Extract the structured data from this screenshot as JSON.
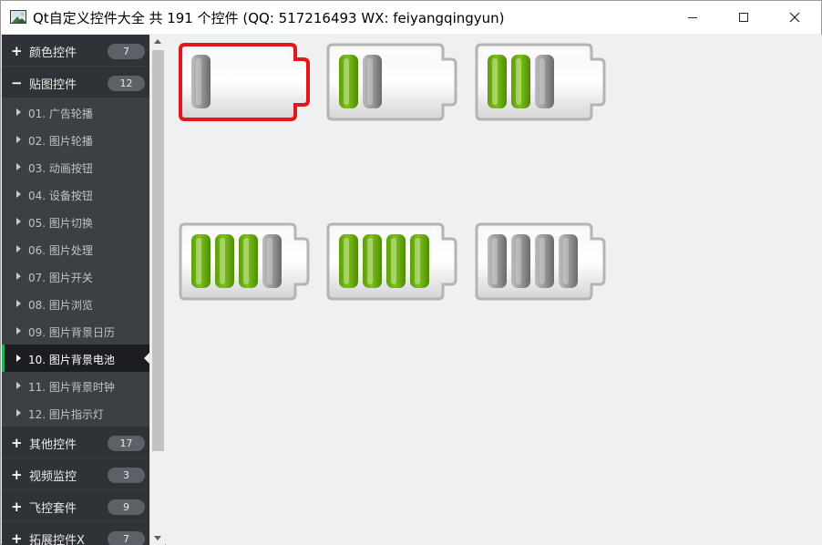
{
  "window": {
    "title": "Qt自定义控件大全 共 191 个控件 (QQ: 517216493 WX: feiyangqingyun)",
    "icon": "app-image-icon"
  },
  "nav": {
    "groups": [
      {
        "sign": "+",
        "label": "颜色控件",
        "count": "7",
        "expanded": false
      },
      {
        "sign": "−",
        "label": "贴图控件",
        "count": "12",
        "expanded": true,
        "items": [
          {
            "label": "01. 广告轮播"
          },
          {
            "label": "02. 图片轮播"
          },
          {
            "label": "03. 动画按钮"
          },
          {
            "label": "04. 设备按钮"
          },
          {
            "label": "05. 图片切换"
          },
          {
            "label": "06. 图片处理"
          },
          {
            "label": "07. 图片开关"
          },
          {
            "label": "08. 图片浏览"
          },
          {
            "label": "09. 图片背景日历"
          },
          {
            "label": "10. 图片背景电池",
            "selected": true
          },
          {
            "label": "11. 图片背景时钟"
          },
          {
            "label": "12. 图片指示灯"
          }
        ]
      },
      {
        "sign": "+",
        "label": "其他控件",
        "count": "17",
        "expanded": false
      },
      {
        "sign": "+",
        "label": "视频监控",
        "count": "3",
        "expanded": false
      },
      {
        "sign": "+",
        "label": "飞控套件",
        "count": "9",
        "expanded": false
      },
      {
        "sign": "+",
        "label": "拓展控件X",
        "count": "7",
        "expanded": false
      }
    ]
  },
  "batteries": [
    {
      "total_cells": 1,
      "green_cells": 0,
      "alarm": true
    },
    {
      "total_cells": 2,
      "green_cells": 1,
      "alarm": false
    },
    {
      "total_cells": 3,
      "green_cells": 2,
      "alarm": false
    },
    {
      "total_cells": 4,
      "green_cells": 3,
      "alarm": false
    },
    {
      "total_cells": 4,
      "green_cells": 4,
      "alarm": false
    },
    {
      "total_cells": 4,
      "green_cells": 0,
      "alarm": false
    }
  ],
  "colors": {
    "nav_bg": "#2f3337",
    "nav_child_bg": "#3b4045",
    "nav_selected_bg": "#1b1d20",
    "accent": "#22b35b",
    "cell_green": "#7dc21a",
    "cell_gray": "#8e8e8e",
    "alarm_border": "#e8141b"
  }
}
